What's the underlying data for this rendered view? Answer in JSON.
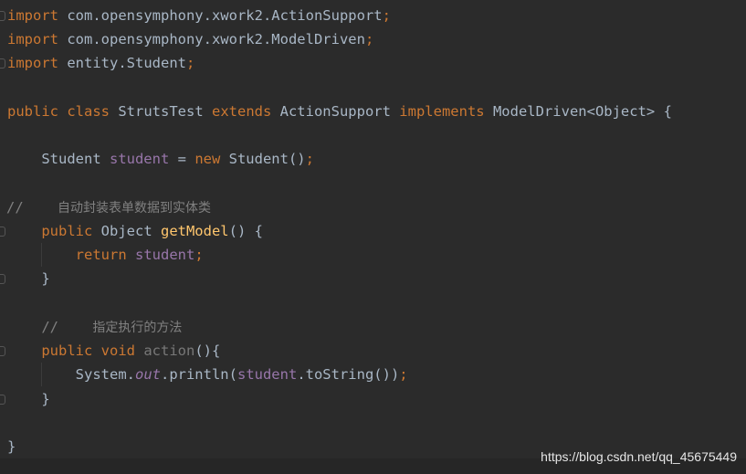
{
  "code": {
    "l1": {
      "kw": "import",
      "path": " com.opensymphony.xwork2.ActionSupport",
      "semi": ";"
    },
    "l2": {
      "kw": "import",
      "path": " com.opensymphony.xwork2.ModelDriven",
      "semi": ";"
    },
    "l3": {
      "kw": "import",
      "path": " entity.Student",
      "semi": ";"
    },
    "l5": {
      "public": "public",
      "class": " class",
      "name": " StrutsTest",
      "extends": " extends",
      "parent": " ActionSupport",
      "implements": " implements",
      "iface": " ModelDriven<Object> {"
    },
    "l7": {
      "type": "    Student ",
      "field": "student",
      "eq": " = ",
      "new": "new",
      "ctor": " Student()",
      "semi": ";"
    },
    "l9": {
      "slashes": "//",
      "spaces": "    ",
      "text": "自动封装表单数据到实体类"
    },
    "l10": {
      "public": "    public",
      "rtype": " Object ",
      "method": "getModel",
      "rest": "() {"
    },
    "l11": {
      "indent": "        ",
      "kw": "return",
      "sp": " ",
      "field": "student",
      "semi": ";"
    },
    "l12": {
      "brace": "    }"
    },
    "l14": {
      "slashes": "    //",
      "spaces": "    ",
      "text": "指定执行的方法"
    },
    "l15": {
      "public": "    public",
      "void": " void",
      "sp": " ",
      "method": "action",
      "rest": "(){"
    },
    "l16": {
      "pre": "        System.",
      "out": "out",
      "mid": ".println(",
      "field": "student",
      "post": ".toString())",
      "semi": ";"
    },
    "l17": {
      "brace": "    }"
    },
    "l19": {
      "brace": "}"
    }
  },
  "watermark": "https://blog.csdn.net/qq_45675449",
  "colors": {
    "background": "#2b2b2b",
    "keyword": "#cc7832",
    "text": "#a9b7c6",
    "field": "#9876aa",
    "method": "#ffc66d",
    "comment": "#808080"
  }
}
